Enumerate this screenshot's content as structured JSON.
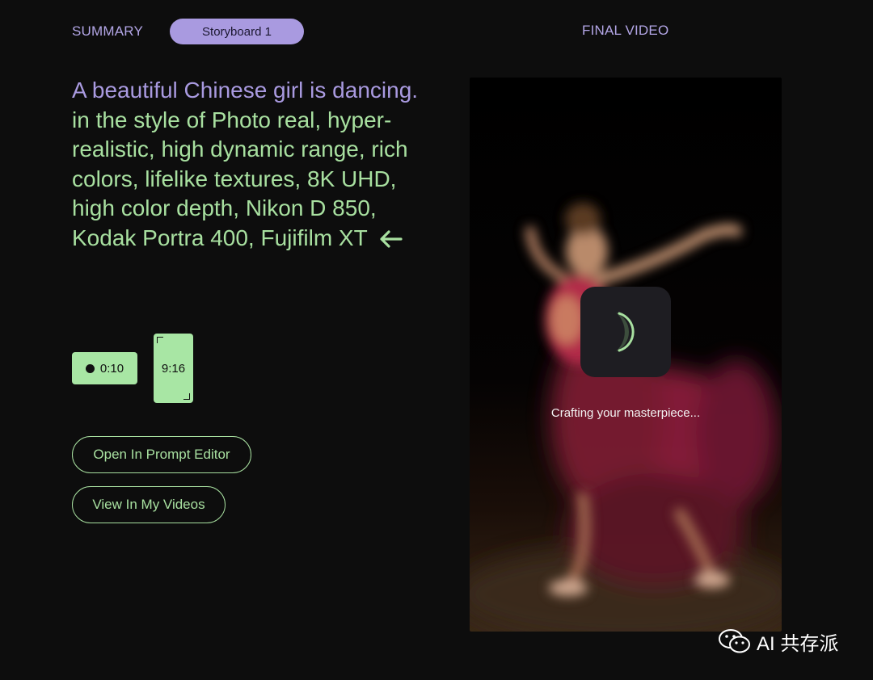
{
  "nav": {
    "summary_label": "SUMMARY",
    "storyboard_label": "Storyboard 1",
    "final_video_label": "FINAL VIDEO"
  },
  "prompt": {
    "subject": "A beautiful Chinese girl is dancing.",
    "style": "in the style of Photo real, hyper-realistic, high dynamic range, rich colors, lifelike textures, 8K UHD, high color depth, Nikon D 850, Kodak Portra 400, Fujifilm XT",
    "arrow_icon": "arrow-left-icon"
  },
  "settings": {
    "duration": "0:10",
    "aspect_ratio": "9:16"
  },
  "actions": {
    "open_prompt_editor": "Open In Prompt Editor",
    "view_my_videos": "View In My Videos"
  },
  "video": {
    "status": "Crafting your masterpiece...",
    "spinner_icon": "loading-spinner-icon"
  },
  "watermark": {
    "text": "AI 共存派",
    "icon": "wechat-icon"
  },
  "colors": {
    "background": "#0d0d0d",
    "purple_accent": "#a99ae0",
    "green_accent": "#a8e0a0",
    "spinner_box": "#1e1d22"
  }
}
